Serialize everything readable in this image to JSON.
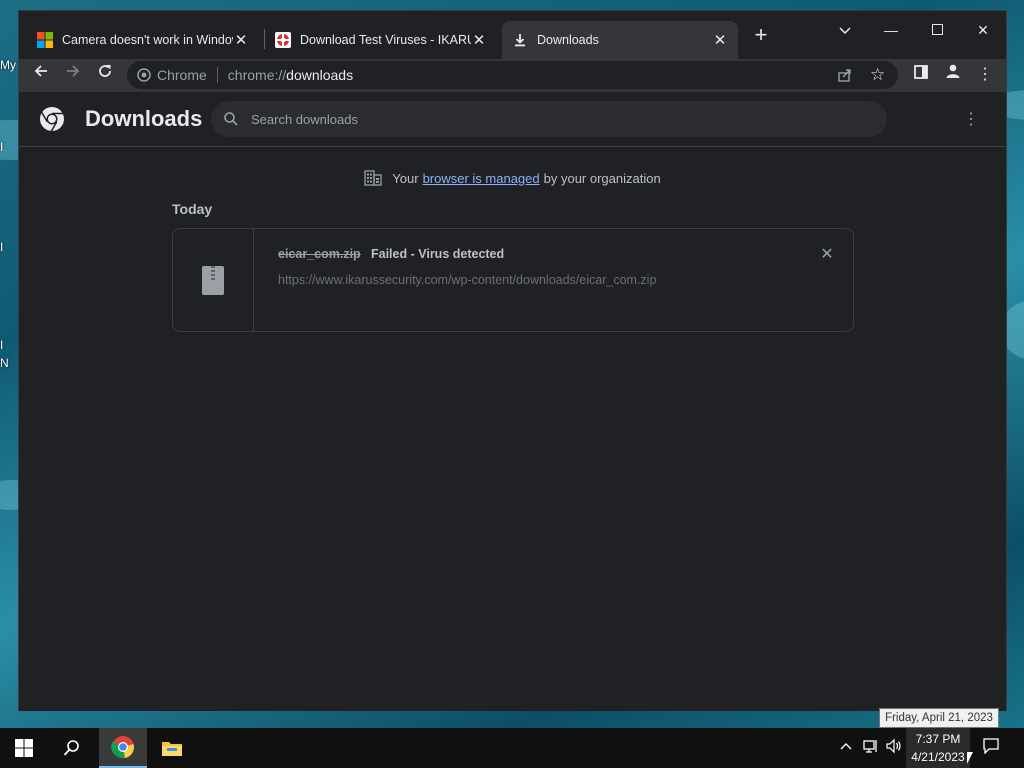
{
  "desktop": {
    "labels": [
      "My",
      "I",
      "I",
      "I",
      "N"
    ]
  },
  "tabs": [
    {
      "title": "Camera doesn't work in Windows",
      "favicon": "microsoft-icon"
    },
    {
      "title": "Download Test Viruses - IKARUS",
      "favicon": "ikarus-icon"
    },
    {
      "title": "Downloads",
      "favicon": "download-icon",
      "active": true
    }
  ],
  "toolbar": {
    "site_label": "Chrome",
    "url_prefix": "chrome://",
    "url_host": "downloads"
  },
  "page": {
    "title": "Downloads",
    "search_placeholder": "Search downloads",
    "managed_prefix": "Your",
    "managed_link": "browser is managed",
    "managed_suffix": "by your organization",
    "date_heading": "Today",
    "items": [
      {
        "file_name": "eicar_com.zip",
        "status": "Failed - Virus detected",
        "url": "https://www.ikarussecurity.com/wp-content/downloads/eicar_com.zip"
      }
    ]
  },
  "tooltip": "Friday, April 21, 2023",
  "clock": {
    "time": "7:37 PM",
    "date": "4/21/2023"
  },
  "colors": {
    "accent": "#8ab4f8",
    "background": "#202124",
    "taskbar": "#101010"
  }
}
